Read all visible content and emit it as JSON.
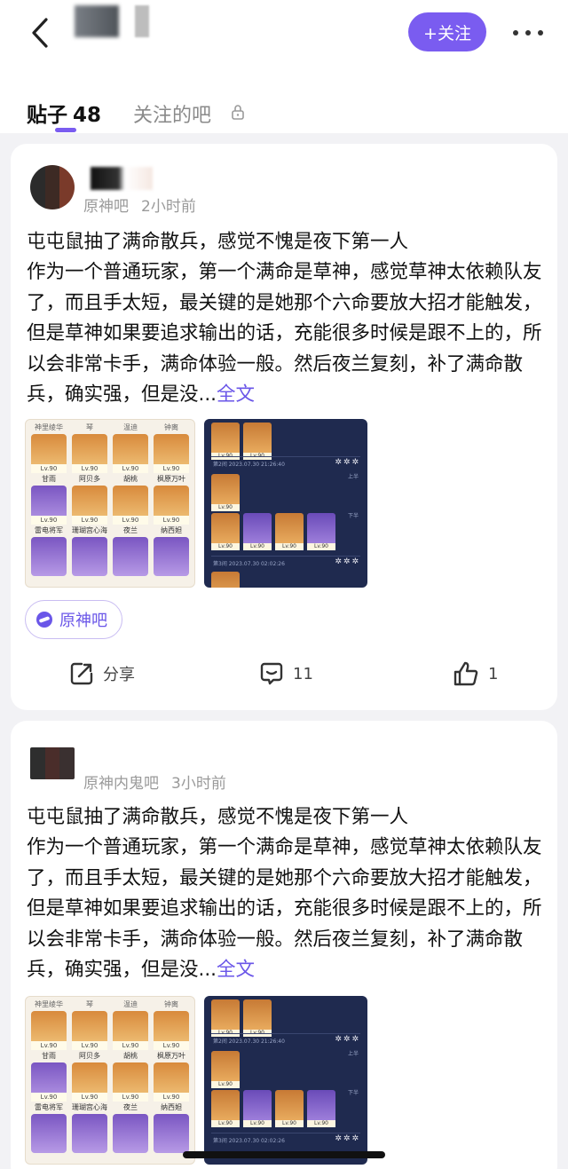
{
  "header": {
    "follow_label": "+关注"
  },
  "tabs": {
    "posts_label": "贴子",
    "posts_count": "48",
    "followed_label": "关注的吧"
  },
  "posts": [
    {
      "forum": "原神吧",
      "time": "2小时前",
      "title": "屯屯鼠抽了满命散兵，感觉不愧是夜下第一人",
      "body": "作为一个普通玩家，第一个满命是草神，感觉草神太依赖队友了，而且手太短，最关键的是她那个六命要放大招才能触发，但是草神如果要追求输出的话，充能很多时候是跟不上的，所以会非常卡手，满命体验一般。然后夜兰复刻，补了满命散兵，确实强，但是没...",
      "more_label": "全文",
      "forum_chip": "原神吧",
      "share_label": "分享",
      "comment_count": "11",
      "like_count": "1"
    },
    {
      "forum": "原神内鬼吧",
      "time": "3小时前",
      "title": "屯屯鼠抽了满命散兵，感觉不愧是夜下第一人",
      "body": "作为一个普通玩家，第一个满命是草神，感觉草神太依赖队友了，而且手太短，最关键的是她那个六命要放大招才能触发，但是草神如果要追求输出的话，充能很多时候是跟不上的，所以会非常卡手，满命体验一般。然后夜兰复刻，补了满命散兵，确实强，但是没...",
      "more_label": "全文"
    }
  ],
  "thumbnail": {
    "headers": [
      "神里绫华",
      "琴",
      "温迪",
      "钟离"
    ],
    "names": [
      "甘雨",
      "阿贝多",
      "胡桃",
      "枫原万叶",
      "雷电将军",
      "珊瑚宫心海",
      "夜兰",
      "纳西妲"
    ],
    "level": "Lv.90",
    "dark_labels": [
      "第2间 2023.07.30 21:26:40",
      "第3间 2023.07.30 02:02:26"
    ],
    "half_up": "上半",
    "half_down": "下半",
    "stars": "✲✲✲"
  },
  "colors": {
    "accent": "#7a5cf0",
    "link": "#6a56e8"
  }
}
